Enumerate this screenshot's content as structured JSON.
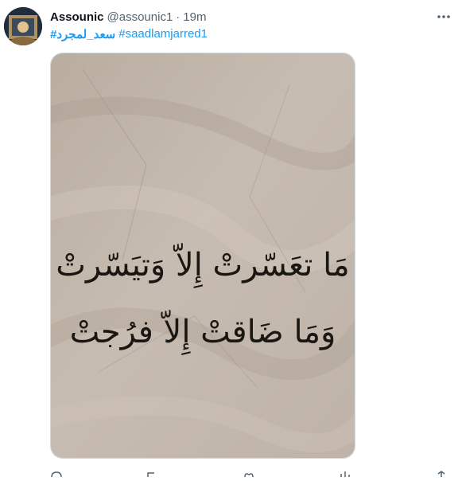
{
  "tweet": {
    "author_name": "Assounic",
    "author_handle": "@assounic1",
    "separator": "·",
    "time": "19m",
    "hashtag_arabic": "سعد_لمجرد#",
    "hashtag_latin": "#saadlamjarred1",
    "image_text_line1": "مَا تعَسّرتْ إِلاّ وَتيَسّرتْ",
    "image_text_line2": "وَمَا ضَاقتْ إِلاّ فرُجتْ"
  },
  "icons": {
    "more": "more-horizontal-icon"
  },
  "colors": {
    "link": "#1d9bf0",
    "muted": "#536471",
    "text": "#0f1419"
  }
}
